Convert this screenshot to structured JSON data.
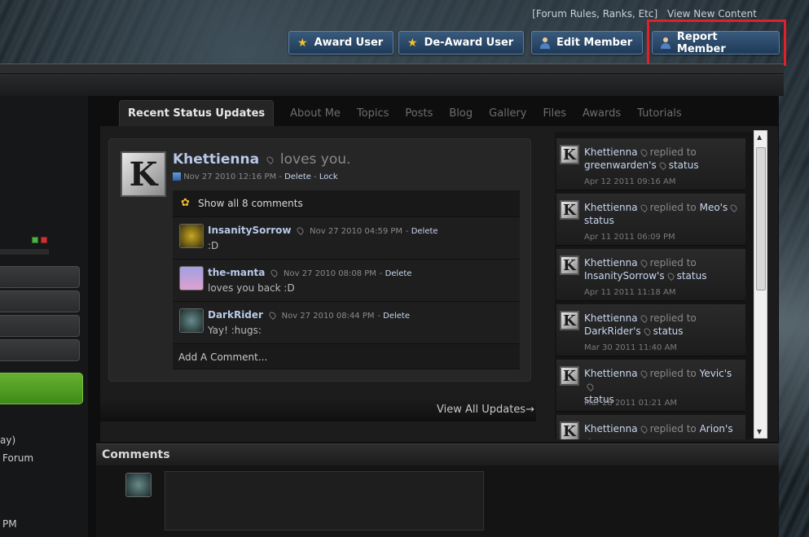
{
  "top_links": {
    "forum_rules": "[Forum Rules, Ranks, Etc]",
    "view_new": "View New Content"
  },
  "buttons": {
    "award": "Award User",
    "deaward": "De-Award User",
    "edit": "Edit Member",
    "report": "Report Member"
  },
  "left": {
    "line1": "ay)",
    "line2": "Forum",
    "line3": "PM"
  },
  "tabs": [
    "Recent Status Updates",
    "About Me",
    "Topics",
    "Posts",
    "Blog",
    "Gallery",
    "Files",
    "Awards",
    "Tutorials"
  ],
  "status": {
    "user": "Khettienna",
    "message": "loves you.",
    "date": "Nov 27 2010 12:16 PM",
    "delete": "Delete",
    "lock": "Lock",
    "show_all": "Show all 8 comments",
    "add_comment": "Add A Comment...",
    "view_all": "View All Updates→",
    "comments": [
      {
        "user": "InsanitySorrow",
        "date": "Nov 27 2010 04:59 PM",
        "delete": "Delete",
        "text": ":D"
      },
      {
        "user": "the-manta",
        "date": "Nov 27 2010 08:08 PM",
        "delete": "Delete",
        "text": "loves you back :D"
      },
      {
        "user": "DarkRider",
        "date": "Nov 27 2010 08:44 PM",
        "delete": "Delete",
        "text": "Yay! :hugs:"
      }
    ]
  },
  "replies": [
    {
      "user": "Khettienna",
      "verb": "replied to",
      "target": "greenwarden",
      "suffix": "'s",
      "status": "status",
      "time": "Apr 12 2011 09:16 AM"
    },
    {
      "user": "Khettienna",
      "verb": "replied to",
      "target": "Meo",
      "suffix": "'s",
      "status": "status",
      "time": "Apr 11 2011 06:09 PM"
    },
    {
      "user": "Khettienna",
      "verb": "replied to",
      "target": "InsanitySorrow",
      "suffix": "'s",
      "status": "status",
      "time": "Apr 11 2011 11:18 AM"
    },
    {
      "user": "Khettienna",
      "verb": "replied to",
      "target": "DarkRider",
      "suffix": "'s",
      "status": "status",
      "time": "Mar 30 2011 11:40 AM"
    },
    {
      "user": "Khettienna",
      "verb": "replied to",
      "target": "Yevic",
      "suffix": "'s",
      "status": "status",
      "time": "Mar 28 2011 01:21 AM"
    },
    {
      "user": "Khettienna",
      "verb": "replied to",
      "target": "Arion",
      "suffix": "'s",
      "status": "",
      "time": ""
    }
  ],
  "comments_heading": "Comments",
  "avatar_letter": "K",
  "icons": {
    "award": "star-badge-icon",
    "deaward": "star-badge-icon",
    "person": "person-icon",
    "pin": "location-pin-icon"
  },
  "colors": {
    "button_bg": "#2a4a6c",
    "highlight": "#e0202a",
    "green": "#5aa024"
  }
}
